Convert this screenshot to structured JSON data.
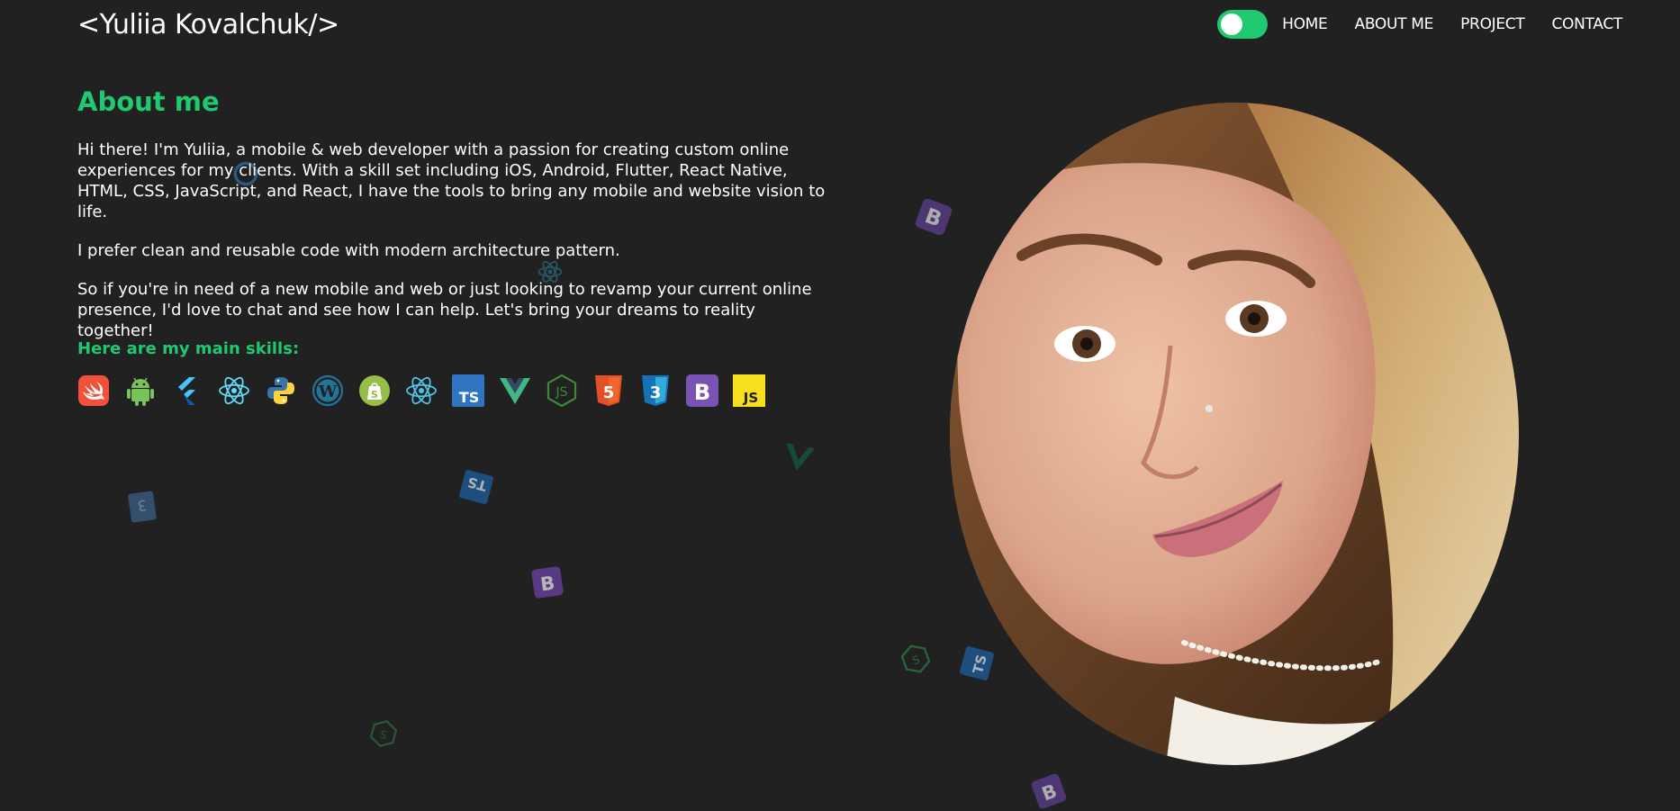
{
  "logo": "<Yuliia Kovalchuk/>",
  "nav": {
    "toggle_state": "on",
    "links": [
      "HOME",
      "ABOUT ME",
      "PROJECT",
      "CONTACT"
    ]
  },
  "about": {
    "title": "About me",
    "paragraphs": [
      "Hi there! I'm Yuliia, a mobile & web developer with a passion for creating custom online experiences for my clients. With a skill set including iOS, Android, Flutter, React Native, HTML, CSS, JavaScript, and React, I have the tools to bring any mobile and website vision to life.",
      "I prefer clean and reusable code with modern architecture pattern.",
      "So if you're in need of a new mobile and web or just looking to revamp your current online presence, I'd love to chat and see how I can help. Let's bring your dreams to reality together!"
    ],
    "skills_title": "Here are my main skills:",
    "skills": [
      "swift-icon",
      "android-icon",
      "flutter-icon",
      "react-icon",
      "python-icon",
      "wordpress-icon",
      "shopify-icon",
      "react-native-icon",
      "typescript-icon",
      "vue-icon",
      "nodejs-icon",
      "html5-icon",
      "css3-icon",
      "bootstrap-icon",
      "javascript-icon"
    ],
    "skill_badges": {
      "typescript": "TS",
      "bootstrap": "B",
      "javascript": "JS",
      "html": "5",
      "css": "3"
    }
  },
  "photo": {
    "name": "profile-photo"
  },
  "colors": {
    "background": "#212121",
    "accent": "#1ec96f",
    "text": "#ffffff"
  }
}
